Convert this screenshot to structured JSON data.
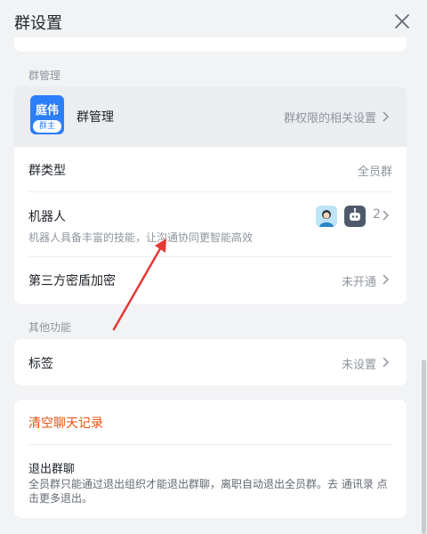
{
  "header": {
    "title": "群设置"
  },
  "group_management": {
    "section_label": "群管理",
    "admin": {
      "avatar_text": "庭伟",
      "owner_badge": "群主",
      "label": "群管理",
      "value": "群权限的相关设置"
    },
    "group_type": {
      "label": "群类型",
      "value": "全员群"
    },
    "robot": {
      "label": "机器人",
      "description": "机器人具备丰富的技能，让沟通协同更智能高效",
      "count": "2"
    },
    "encryption": {
      "label": "第三方密盾加密",
      "value": "未开通"
    }
  },
  "other_functions": {
    "section_label": "其他功能",
    "tags": {
      "label": "标签",
      "value": "未设置"
    }
  },
  "danger_zone": {
    "clear_history": "清空聊天记录",
    "exit_group": {
      "label": "退出群聊",
      "description": "全员群只能通过退出组织才能退出群聊，离职自动退出全员群。去 通讯录 点击更多退出。"
    }
  },
  "colors": {
    "accent": "#2d7ff9",
    "danger": "#e8520f",
    "annotation_arrow": "#e53935"
  },
  "icons": [
    "close-icon",
    "chevron-right-icon",
    "robot-icon",
    "person-bot-avatar"
  ]
}
